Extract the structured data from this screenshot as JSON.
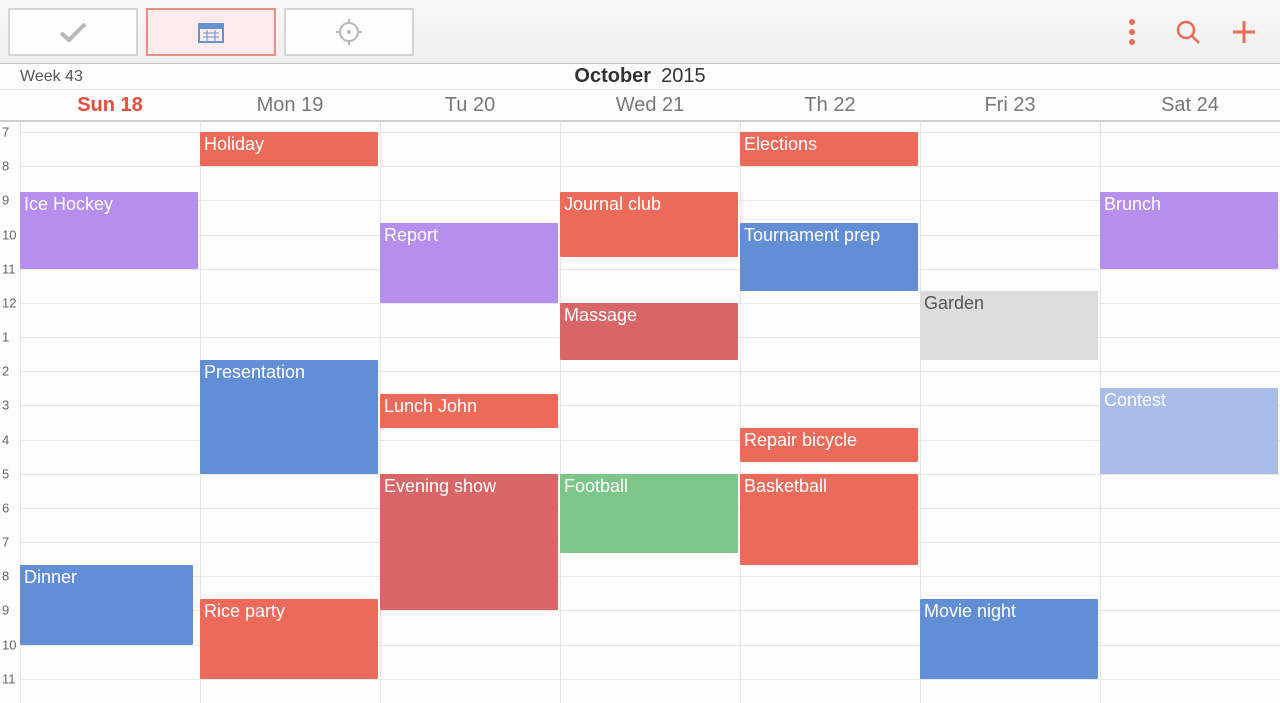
{
  "toolbar": {
    "tabs": [
      {
        "name": "todo-tab",
        "icon": "check",
        "active": false
      },
      {
        "name": "calendar-tab",
        "icon": "calendar",
        "active": true
      },
      {
        "name": "focus-tab",
        "icon": "target",
        "active": false
      }
    ],
    "actions": [
      {
        "name": "overflow-icon",
        "icon": "dots"
      },
      {
        "name": "search-icon",
        "icon": "search"
      },
      {
        "name": "add-icon",
        "icon": "plus"
      }
    ]
  },
  "header": {
    "week_label": "Week 43",
    "month": "October",
    "year": "2015"
  },
  "days": [
    {
      "label": "Sun 18",
      "today": true
    },
    {
      "label": "Mon 19",
      "today": false
    },
    {
      "label": "Tu 20",
      "today": false
    },
    {
      "label": "Wed 21",
      "today": false
    },
    {
      "label": "Th 22",
      "today": false
    },
    {
      "label": "Fri 23",
      "today": false
    },
    {
      "label": "Sat 24",
      "today": false
    }
  ],
  "hours": [
    7,
    8,
    9,
    10,
    11,
    12,
    1,
    2,
    3,
    4,
    5,
    6,
    7,
    8,
    9,
    10,
    11
  ],
  "colors": {
    "red": "#ec6a5a",
    "purple": "#b68eed",
    "blue": "#628ed6",
    "lblue": "#a9bde8",
    "rose": "#d96667",
    "green": "#7cc689",
    "grey": "#dddddd"
  },
  "events": [
    {
      "title": "Holiday",
      "day": 1,
      "start": 7,
      "end": 8,
      "color": "red"
    },
    {
      "title": "Elections",
      "day": 4,
      "start": 7,
      "end": 8,
      "color": "red"
    },
    {
      "title": "Ice Hockey",
      "day": 0,
      "start": 8.75,
      "end": 11,
      "color": "purple"
    },
    {
      "title": "Journal club",
      "day": 3,
      "start": 8.75,
      "end": 10.666,
      "color": "red"
    },
    {
      "title": "Brunch",
      "day": 6,
      "start": 8.75,
      "end": 11,
      "color": "purple"
    },
    {
      "title": "Report",
      "day": 2,
      "start": 9.666,
      "end": 12,
      "color": "purple"
    },
    {
      "title": "Tournament prep",
      "day": 4,
      "start": 9.666,
      "end": 11.666,
      "color": "blue"
    },
    {
      "title": "Garden",
      "day": 5,
      "start": 11.666,
      "end": 13.666,
      "color": "grey"
    },
    {
      "title": "Massage",
      "day": 3,
      "start": 12,
      "end": 13.666,
      "color": "rose"
    },
    {
      "title": "Presentation",
      "day": 1,
      "start": 13.666,
      "end": 17,
      "color": "blue"
    },
    {
      "title": "Lunch John",
      "day": 2,
      "start": 14.666,
      "end": 15.666,
      "color": "red"
    },
    {
      "title": "Contest",
      "day": 6,
      "start": 14.5,
      "end": 17,
      "color": "lblue"
    },
    {
      "title": "Repair bicycle",
      "day": 4,
      "start": 15.666,
      "end": 16.666,
      "color": "red"
    },
    {
      "title": "Evening show",
      "day": 2,
      "start": 17,
      "end": 21,
      "color": "rose"
    },
    {
      "title": "Football",
      "day": 3,
      "start": 17,
      "end": 19.333,
      "color": "green"
    },
    {
      "title": "Basketball",
      "day": 4,
      "start": 17,
      "end": 19.666,
      "color": "red"
    },
    {
      "title": "Dinner",
      "day": 0,
      "start": 19.666,
      "end": 22,
      "color": "blue",
      "narrow": true
    },
    {
      "title": "Rice party",
      "day": 1,
      "start": 20.666,
      "end": 23,
      "color": "red"
    },
    {
      "title": "Movie night",
      "day": 5,
      "start": 20.666,
      "end": 23,
      "color": "blue"
    }
  ]
}
